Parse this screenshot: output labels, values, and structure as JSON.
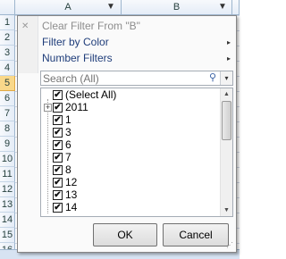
{
  "sheet": {
    "corner_icon": "select-all-triangle-icon",
    "columns": [
      {
        "label": "A",
        "filter_icon": "filter-funnel-icon"
      },
      {
        "label": "B",
        "filter_icon": "filter-funnel-icon"
      }
    ],
    "rows": [
      "1",
      "2",
      "3",
      "4",
      "5",
      "6",
      "7",
      "8",
      "9",
      "10",
      "11",
      "12",
      "13",
      "14",
      "15",
      "16"
    ],
    "active_row": "5"
  },
  "menu": {
    "clear_filter": {
      "label": "Clear Filter From \"B\"",
      "icon": "clear-filter-icon",
      "enabled": false
    },
    "filter_by_color": {
      "label": "Filter by Color",
      "arrow": "▸"
    },
    "number_filters": {
      "label": "Number Filters",
      "arrow": "▸"
    }
  },
  "search": {
    "placeholder": "Search (All)",
    "icon": "magnifier-icon",
    "dropdown_glyph": "▾"
  },
  "list": {
    "items": [
      {
        "label": "(Select All)",
        "checked": true
      },
      {
        "label": "2011",
        "checked": true,
        "expandable": true
      },
      {
        "label": "1",
        "checked": true
      },
      {
        "label": "3",
        "checked": true
      },
      {
        "label": "6",
        "checked": true
      },
      {
        "label": "7",
        "checked": true
      },
      {
        "label": "8",
        "checked": true
      },
      {
        "label": "12",
        "checked": true
      },
      {
        "label": "13",
        "checked": true
      },
      {
        "label": "14",
        "checked": true
      }
    ],
    "check_glyph": "✔",
    "expander_glyph": "+"
  },
  "buttons": {
    "ok": "OK",
    "cancel": "Cancel"
  },
  "colors": {
    "menu_text": "#1f3d7a",
    "disabled_text": "#8d8d8d",
    "active_row": "#f9d88a"
  }
}
